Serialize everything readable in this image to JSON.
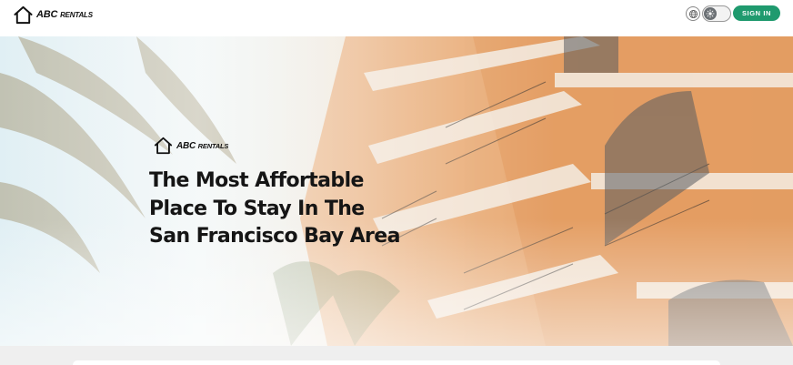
{
  "header": {
    "logo": {
      "brand": "ABC",
      "suffix": "RENTALS",
      "icon": "house-icon"
    },
    "language_icon": "globe-icon",
    "theme_toggle_icon": "sun-icon",
    "signin_label": "SIGN IN"
  },
  "hero": {
    "logo": {
      "brand": "ABC",
      "suffix": "RENTALS",
      "icon": "house-icon"
    },
    "title_lines": [
      "The Most Affortable",
      "Place To Stay In The",
      "San Francisco Bay Area"
    ]
  },
  "colors": {
    "accent": "#1f9a6e",
    "title": "#151515"
  }
}
